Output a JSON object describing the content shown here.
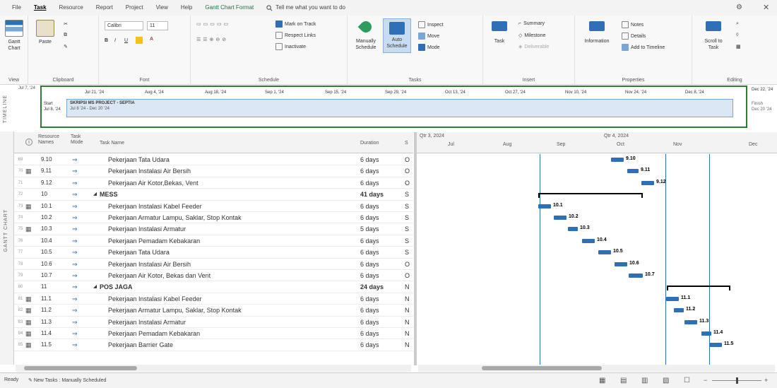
{
  "tabs": [
    "File",
    "Task",
    "Resource",
    "Report",
    "Project",
    "View",
    "Help",
    "Gantt Chart Format"
  ],
  "tell_me": "Tell me what you want to do",
  "ribbon": {
    "view": {
      "btn": "Gantt Chart",
      "label": "View"
    },
    "clipboard": {
      "paste": "Paste",
      "label": "Clipboard"
    },
    "font": {
      "name": "Calibri",
      "size": "11",
      "label": "Font"
    },
    "schedule": {
      "mark_on_track": "Mark on Track",
      "respect_links": "Respect Links",
      "inactivate": "Inactivate",
      "label": "Schedule"
    },
    "tasks": {
      "manually": "Manually Schedule",
      "auto": "Auto Schedule",
      "inspect": "Inspect",
      "move": "Move",
      "mode": "Mode",
      "label": "Tasks"
    },
    "insert": {
      "task": "Task",
      "summary": "Summary",
      "milestone": "Milestone",
      "deliverable": "Deliverable",
      "label": "Insert"
    },
    "properties": {
      "information": "Information",
      "notes": "Notes",
      "details": "Details",
      "add_timeline": "Add to Timeline",
      "label": "Properties"
    },
    "editing": {
      "scroll": "Scroll to Task",
      "label": "Editing"
    }
  },
  "timeline": {
    "side": "TIMELINE",
    "today": "Jul 7, '24",
    "dates": [
      "Jul 21, '24",
      "Aug 4, '24",
      "Aug 18, '24",
      "Sep 1, '24",
      "Sep 15, '24",
      "Sep 29, '24",
      "Oct 13, '24",
      "Oct 27, '24",
      "Nov 10, '24",
      "Nov 24, '24",
      "Dec 8, '24"
    ],
    "end_date": "Dec 22, '24",
    "start_label": "Start",
    "start_date": "Jul 8, '24",
    "bar_title": "SKRIPSI MS PROJECT - SEPTIA",
    "bar_dates": "Jul 8 '24 - Dec 20 '24",
    "finish_label": "Finish",
    "finish_date": "Dec 20 '24"
  },
  "grid": {
    "side": "GANTT CHART",
    "cols": {
      "res": "Resource Names",
      "mode": "Task Mode",
      "name": "Task Name",
      "dur": "Duration",
      "s": "S"
    },
    "rows": [
      {
        "id": "69",
        "info": "",
        "wbs": "9.10",
        "name": "Pekerjaan Tata Udara",
        "dur": "6 days",
        "s": "O",
        "sum": false
      },
      {
        "id": "70",
        "info": "cal",
        "wbs": "9.11",
        "name": "Pekerjaan Instalasi Air Bersih",
        "dur": "6 days",
        "s": "O",
        "sum": false
      },
      {
        "id": "71",
        "info": "",
        "wbs": "9.12",
        "name": "Pekerjaan Air Kotor,Bekas, Vent",
        "dur": "6 days",
        "s": "O",
        "sum": false
      },
      {
        "id": "72",
        "info": "",
        "wbs": "10",
        "name": "MESS",
        "dur": "41 days",
        "s": "S",
        "sum": true
      },
      {
        "id": "73",
        "info": "cal",
        "wbs": "10.1",
        "name": "Pekerjaan Instalasi Kabel Feeder",
        "dur": "6 days",
        "s": "S",
        "sum": false
      },
      {
        "id": "74",
        "info": "",
        "wbs": "10.2",
        "name": "Pekerjaan Armatur Lampu, Saklar, Stop Kontak",
        "dur": "6 days",
        "s": "S",
        "sum": false
      },
      {
        "id": "75",
        "info": "cal",
        "wbs": "10.3",
        "name": "Pekerjaan Instalasi Armatur",
        "dur": "5 days",
        "s": "S",
        "sum": false
      },
      {
        "id": "76",
        "info": "",
        "wbs": "10.4",
        "name": "Pekerjaan Pemadam Kebakaran",
        "dur": "6 days",
        "s": "S",
        "sum": false
      },
      {
        "id": "77",
        "info": "",
        "wbs": "10.5",
        "name": "Pekerjaan Tata Udara",
        "dur": "6 days",
        "s": "S",
        "sum": false
      },
      {
        "id": "78",
        "info": "",
        "wbs": "10.6",
        "name": "Pekerjaan Instalasi Air Bersih",
        "dur": "6 days",
        "s": "O",
        "sum": false
      },
      {
        "id": "79",
        "info": "",
        "wbs": "10.7",
        "name": "Pekerjaan Air Kotor, Bekas dan Vent",
        "dur": "6 days",
        "s": "O",
        "sum": false
      },
      {
        "id": "80",
        "info": "",
        "wbs": "11",
        "name": "POS JAGA",
        "dur": "24 days",
        "s": "N",
        "sum": true
      },
      {
        "id": "81",
        "info": "cal",
        "wbs": "11.1",
        "name": "Pekerjaan Instalasi Kabel Feeder",
        "dur": "6 days",
        "s": "N",
        "sum": false
      },
      {
        "id": "82",
        "info": "cal",
        "wbs": "11.2",
        "name": "Pekerjaan Armatur Lampu, Saklar, Stop Kontak",
        "dur": "6 days",
        "s": "N",
        "sum": false
      },
      {
        "id": "83",
        "info": "cal",
        "wbs": "11.3",
        "name": "Pekerjaan Instalasi Armatur",
        "dur": "6 days",
        "s": "N",
        "sum": false
      },
      {
        "id": "84",
        "info": "cal",
        "wbs": "11.4",
        "name": "Pekerjaan Pemadam Kebakaran",
        "dur": "6 days",
        "s": "N",
        "sum": false
      },
      {
        "id": "85",
        "info": "cal",
        "wbs": "11.5",
        "name": "Pekerjaan Barrier Gate",
        "dur": "6 days",
        "s": "N",
        "sum": false
      }
    ]
  },
  "chart": {
    "tier1": [
      "Qtr 3, 2024",
      "Qtr 4, 2024"
    ],
    "tier2": [
      "Jul",
      "Aug",
      "Sep",
      "Oct",
      "Nov",
      "Dec"
    ],
    "labels": [
      "9.10",
      "9.11",
      "9.12",
      "",
      "10.1",
      "10.2",
      "10.3",
      "10.4",
      "10.5",
      "10.6",
      "10.7",
      "",
      "11.1",
      "11.2",
      "11.3",
      "11.4",
      "11.5"
    ]
  },
  "status": {
    "ready": "Ready",
    "new_tasks": "New Tasks : Manually Scheduled"
  },
  "colors": {
    "bar": "#2f6fb8",
    "timeline_border": "#2e7d32",
    "gantt_tab": "#217346"
  }
}
